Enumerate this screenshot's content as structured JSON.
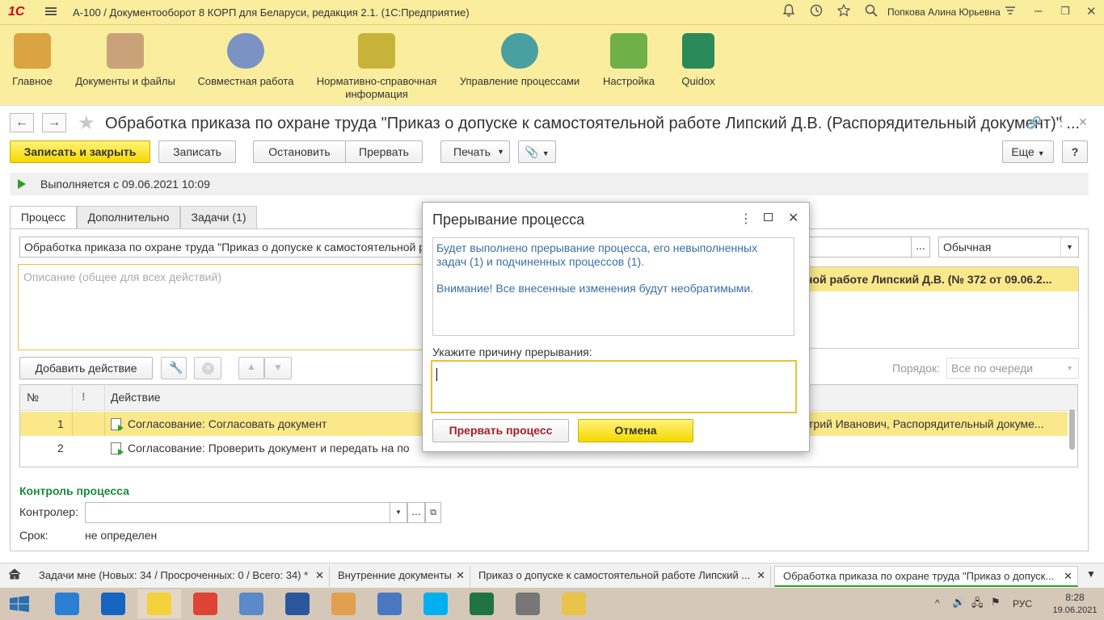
{
  "titlebar": {
    "title": "А-100 / Документооборот 8 КОРП для Беларуси, редакция 2.1.  (1С:Предприятие)",
    "logo": "1С",
    "user": "Попкова Алина Юрьевна"
  },
  "sections": [
    {
      "label": "Главное",
      "color": "#d9a441"
    },
    {
      "label": "Документы и файлы",
      "color": "#c9a27a"
    },
    {
      "label": "Совместная работа",
      "color": "#7a93c4"
    },
    {
      "label": "Нормативно-справочная информация",
      "color": "#c8b33a"
    },
    {
      "label": "Управление процессами",
      "color": "#4aa0a0"
    },
    {
      "label": "Настройка",
      "color": "#6fb04a"
    },
    {
      "label": "Quidox",
      "color": "#2a8a5a"
    }
  ],
  "form": {
    "title": "Обработка приказа по охране труда \"Приказ о допуске к самостоятельной работе Липский Д.В. (Распорядительный документ)\" ...",
    "buttons": {
      "save_close": "Записать и закрыть",
      "save": "Записать",
      "stop": "Остановить",
      "abort": "Прервать",
      "print": "Печать",
      "more": "Еще",
      "help": "?"
    },
    "status": "Выполняется с 09.06.2021 10:09",
    "tabs": [
      "Процесс",
      "Дополнительно",
      "Задачи (1)"
    ],
    "subject_value": "Обработка приказа по охране труда \"Приказ о допуске к самостоятельной работе Липский Д.В.\"",
    "importance_value": "Обычная",
    "description_placeholder": "Описание (общее для всех действий)",
    "right_header": "ной работе Липский Д.В. (№ 372 от 09.06.2...",
    "add_action": "Добавить действие",
    "order_label": "Порядок:",
    "order_value": "Все по очереди",
    "table": {
      "headers": [
        "№",
        "!",
        "Действие"
      ],
      "rows": [
        {
          "num": "1",
          "action": "Согласование: Согласовать документ",
          "right": "трий Иванович, Распорядительный докуме..."
        },
        {
          "num": "2",
          "action": "Согласование: Проверить документ и передать на по",
          "right": ""
        }
      ]
    },
    "control": {
      "header": "Контроль процесса",
      "controller_label": "Контролер:",
      "controller_value": "",
      "deadline_label": "Срок:",
      "deadline_value": "не определен"
    }
  },
  "dialog": {
    "title": "Прерывание процесса",
    "message1": "Будет выполнено прерывание процесса, его невыполненных задач (1) и подчиненных процессов (1).",
    "message2": "Внимание! Все внесенные изменения будут необратимыми.",
    "reason_label": "Укажите причину прерывания:",
    "reason_value": "",
    "abort_button": "Прервать процесс",
    "cancel_button": "Отмена"
  },
  "open_windows": [
    "Задачи мне (Новых: 34 / Просроченных: 0 / Всего: 34) *",
    "Внутренние документы",
    "Приказ о допуске к самостоятельной работе Липский ...",
    "Обработка приказа по охране труда \"Приказ о допуск..."
  ],
  "taskbar": {
    "apps": [
      {
        "name": "ie",
        "color": "#2a7fd4"
      },
      {
        "name": "outlook",
        "color": "#1565c0"
      },
      {
        "name": "1c",
        "color": "#f4d23c"
      },
      {
        "name": "chrome",
        "color": "#dd4433"
      },
      {
        "name": "scanner",
        "color": "#5a8ac8"
      },
      {
        "name": "word",
        "color": "#2b579a"
      },
      {
        "name": "paint",
        "color": "#e0a050"
      },
      {
        "name": "mail",
        "color": "#4a78c0"
      },
      {
        "name": "skype",
        "color": "#00aff0"
      },
      {
        "name": "excel",
        "color": "#217346"
      },
      {
        "name": "device",
        "color": "#777777"
      },
      {
        "name": "explorer",
        "color": "#e8c44a"
      }
    ],
    "lang": "РУС",
    "time": "8:28",
    "date": "19.06.2021"
  }
}
